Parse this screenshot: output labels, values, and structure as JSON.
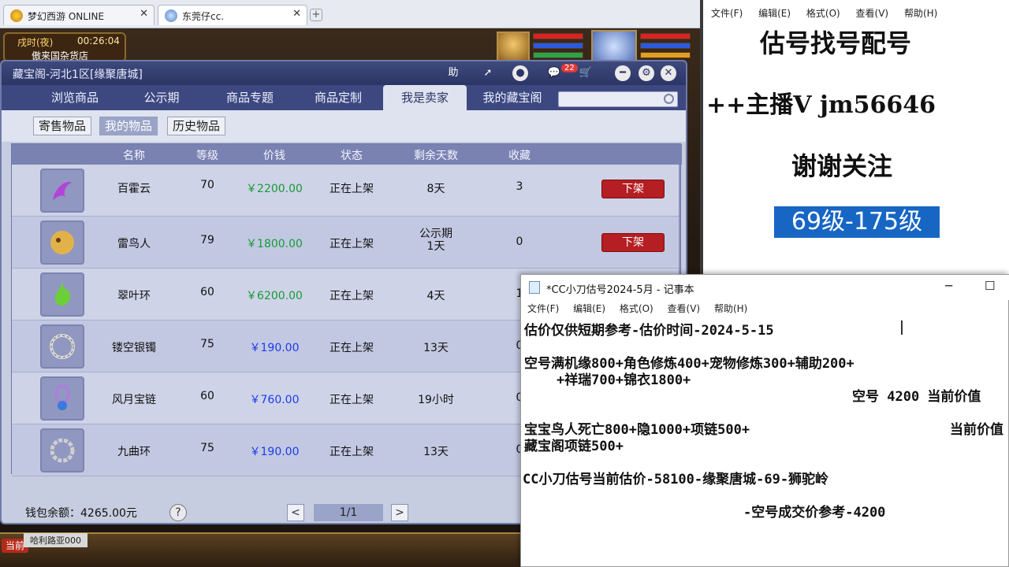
{
  "browser": {
    "tabs": [
      {
        "label": "梦幻西游 ONLINE"
      },
      {
        "label": "东莞仔cc."
      }
    ]
  },
  "game": {
    "time_label": "戌时(夜)",
    "time_value": "00:26:04",
    "location": "傲来国杂货店",
    "current_channel": "当前",
    "chat_name": "哈利路亚000"
  },
  "treasure": {
    "title": "藏宝阁-河北1区[缘聚唐城]",
    "help_glyph": "助",
    "cart_count": "22",
    "nav_tabs": [
      "浏览商品",
      "公示期",
      "商品专题",
      "商品定制",
      "我是卖家",
      "我的藏宝阁"
    ],
    "sub_tabs": [
      "寄售物品",
      "我的物品",
      "历史物品"
    ],
    "columns": [
      "名称",
      "等级",
      "价钱",
      "状态",
      "剩余天数",
      "收藏"
    ],
    "rows": [
      {
        "name": "百霍云",
        "level": "70",
        "price": "￥2200.00",
        "status": "正在上架",
        "days": "8天",
        "fav": "3",
        "action": "下架",
        "price_color": "green"
      },
      {
        "name": "雷鸟人",
        "level": "79",
        "price": "￥1800.00",
        "status": "正在上架",
        "days": "公示期\n1天",
        "fav": "0",
        "action": "下架",
        "price_color": "green"
      },
      {
        "name": "翠叶环",
        "level": "60",
        "price": "￥6200.00",
        "status": "正在上架",
        "days": "4天",
        "fav": "1",
        "action": "",
        "price_color": "green"
      },
      {
        "name": "镂空银镯",
        "level": "75",
        "price": "￥190.00",
        "status": "正在上架",
        "days": "13天",
        "fav": "0",
        "action": "",
        "price_color": "blue"
      },
      {
        "name": "风月宝链",
        "level": "60",
        "price": "￥760.00",
        "status": "正在上架",
        "days": "19小时",
        "fav": "0",
        "action": "",
        "price_color": "blue"
      },
      {
        "name": "九曲环",
        "level": "75",
        "price": "￥190.00",
        "status": "正在上架",
        "days": "13天",
        "fav": "0",
        "action": "",
        "price_color": "blue"
      }
    ],
    "wallet": "钱包余额：4265.00元",
    "help": "?",
    "page": "1/1",
    "prev": "<",
    "next": ">"
  },
  "notepad_back": {
    "menu": [
      "文件(F)",
      "编辑(E)",
      "格式(O)",
      "查看(V)",
      "帮助(H)"
    ],
    "line1": "估号找号配号",
    "line2": "++主播V jm56646",
    "line3": "谢谢关注",
    "highlight": "69级-175级"
  },
  "notepad_front": {
    "title": "*CC小刀估号2024-5月 - 记事本",
    "menu": [
      "文件(F)",
      "编辑(E)",
      "格式(O)",
      "查看(V)",
      "帮助(H)"
    ],
    "lines": [
      "估价仅供短期参考-估价时间-2024-5-15",
      "空号满机缘800+角色修炼400+宠物修炼300+辅助200+",
      "    +祥瑞700+锦衣1800+",
      "空号 4200 当前价值",
      "宝宝鸟人死亡800+隐1000+项链500+",
      "当前价值",
      "藏宝阁项链500+",
      "CC小刀估号当前估价-58100-缘聚唐城-69-狮驼岭",
      "-空号成交价参考-4200"
    ]
  },
  "colors": {
    "accent": "#2b3566",
    "price_green": "#159b35",
    "price_blue": "#1a3ce8",
    "action_red": "#b51e22",
    "highlight_blue": "#1766c4"
  }
}
